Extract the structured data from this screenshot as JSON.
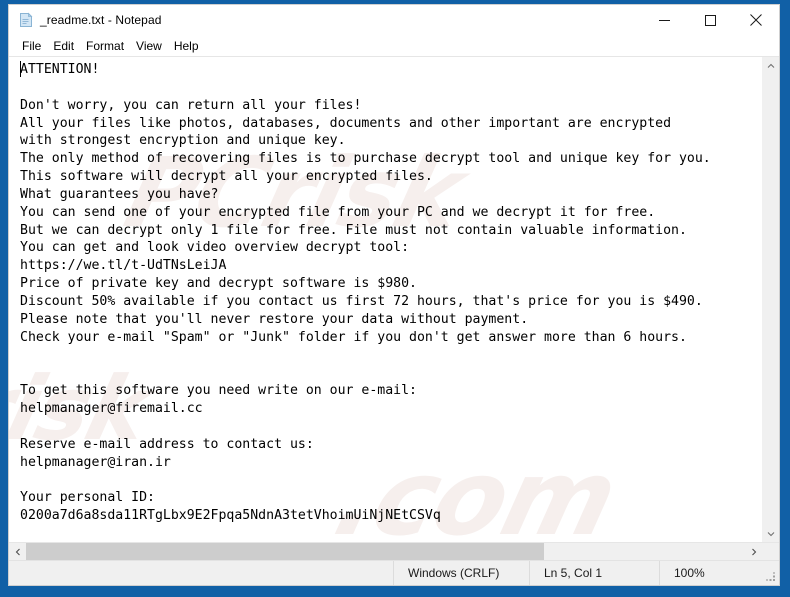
{
  "window": {
    "title": "_readme.txt - Notepad",
    "icon": "notepad-icon",
    "controls": {
      "minimize": "minimize-icon",
      "maximize": "maximize-icon",
      "close": "close-icon"
    }
  },
  "menu": {
    "items": [
      {
        "label": "File"
      },
      {
        "label": "Edit"
      },
      {
        "label": "Format"
      },
      {
        "label": "View"
      },
      {
        "label": "Help"
      }
    ]
  },
  "document": {
    "filename": "_readme.txt",
    "content": "ATTENTION!\n\nDon't worry, you can return all your files!\nAll your files like photos, databases, documents and other important are encrypted\nwith strongest encryption and unique key.\nThe only method of recovering files is to purchase decrypt tool and unique key for you.\nThis software will decrypt all your encrypted files.\nWhat guarantees you have?\nYou can send one of your encrypted file from your PC and we decrypt it for free.\nBut we can decrypt only 1 file for free. File must not contain valuable information.\nYou can get and look video overview decrypt tool:\nhttps://we.tl/t-UdTNsLeiJA\nPrice of private key and decrypt software is $980.\nDiscount 50% available if you contact us first 72 hours, that's price for you is $490.\nPlease note that you'll never restore your data without payment.\nCheck your e-mail \"Spam\" or \"Junk\" folder if you don't get answer more than 6 hours.\n\n\nTo get this software you need write on our e-mail:\nhelpmanager@firemail.cc\n\nReserve e-mail address to contact us:\nhelpmanager@iran.ir\n\nYour personal ID:\n0200a7d6a8sda11RTgLbx9E2Fpqa5NdnA3tetVhoimUiNjNEtCSVq",
    "lines": [
      "ATTENTION!",
      "",
      "Don't worry, you can return all your files!",
      "All your files like photos, databases, documents and other important are encrypted",
      "with strongest encryption and unique key.",
      "The only method of recovering files is to purchase decrypt tool and unique key for you.",
      "This software will decrypt all your encrypted files.",
      "What guarantees you have?",
      "You can send one of your encrypted file from your PC and we decrypt it for free.",
      "But we can decrypt only 1 file for free. File must not contain valuable information.",
      "You can get and look video overview decrypt tool:",
      "https://we.tl/t-UdTNsLeiJA",
      "Price of private key and decrypt software is $980.",
      "Discount 50% available if you contact us first 72 hours, that's price for you is $490.",
      "Please note that you'll never restore your data without payment.",
      "Check your e-mail \"Spam\" or \"Junk\" folder if you don't get answer more than 6 hours.",
      "",
      "",
      "To get this software you need write on our e-mail:",
      "helpmanager@firemail.cc",
      "",
      "Reserve e-mail address to contact us:",
      "helpmanager@iran.ir",
      "",
      "Your personal ID:",
      "0200a7d6a8sda11RTgLbx9E2Fpqa5NdnA3tetVhoimUiNjNEtCSVq"
    ],
    "ransom_details": {
      "video_url": "https://we.tl/t-UdTNsLeiJA",
      "full_price": "$980",
      "discount_price": "$490",
      "discount_percent": "50%",
      "discount_window_hours": "72 hours",
      "response_time_hours": "6 hours",
      "free_decrypt_files": "1 file",
      "primary_email": "helpmanager@firemail.cc",
      "reserve_email": "helpmanager@iran.ir",
      "personal_id": "0200a7d6a8sda11RTgLbx9E2Fpqa5NdnA3tetVhoimUiNjNEtCSVq"
    }
  },
  "watermark": {
    "line1": "PCrisk",
    "line2": ".com",
    "line3": "risk"
  },
  "statusbar": {
    "line_ending": "Windows (CRLF)",
    "cursor_position": "Ln 5, Col 1",
    "zoom": "100%"
  },
  "colors": {
    "desktop_blue": "#1160a6",
    "window_bg": "#ffffff",
    "chrome_gray": "#f0f0f0",
    "scroll_thumb": "#cdcdcd",
    "text": "#000000"
  }
}
